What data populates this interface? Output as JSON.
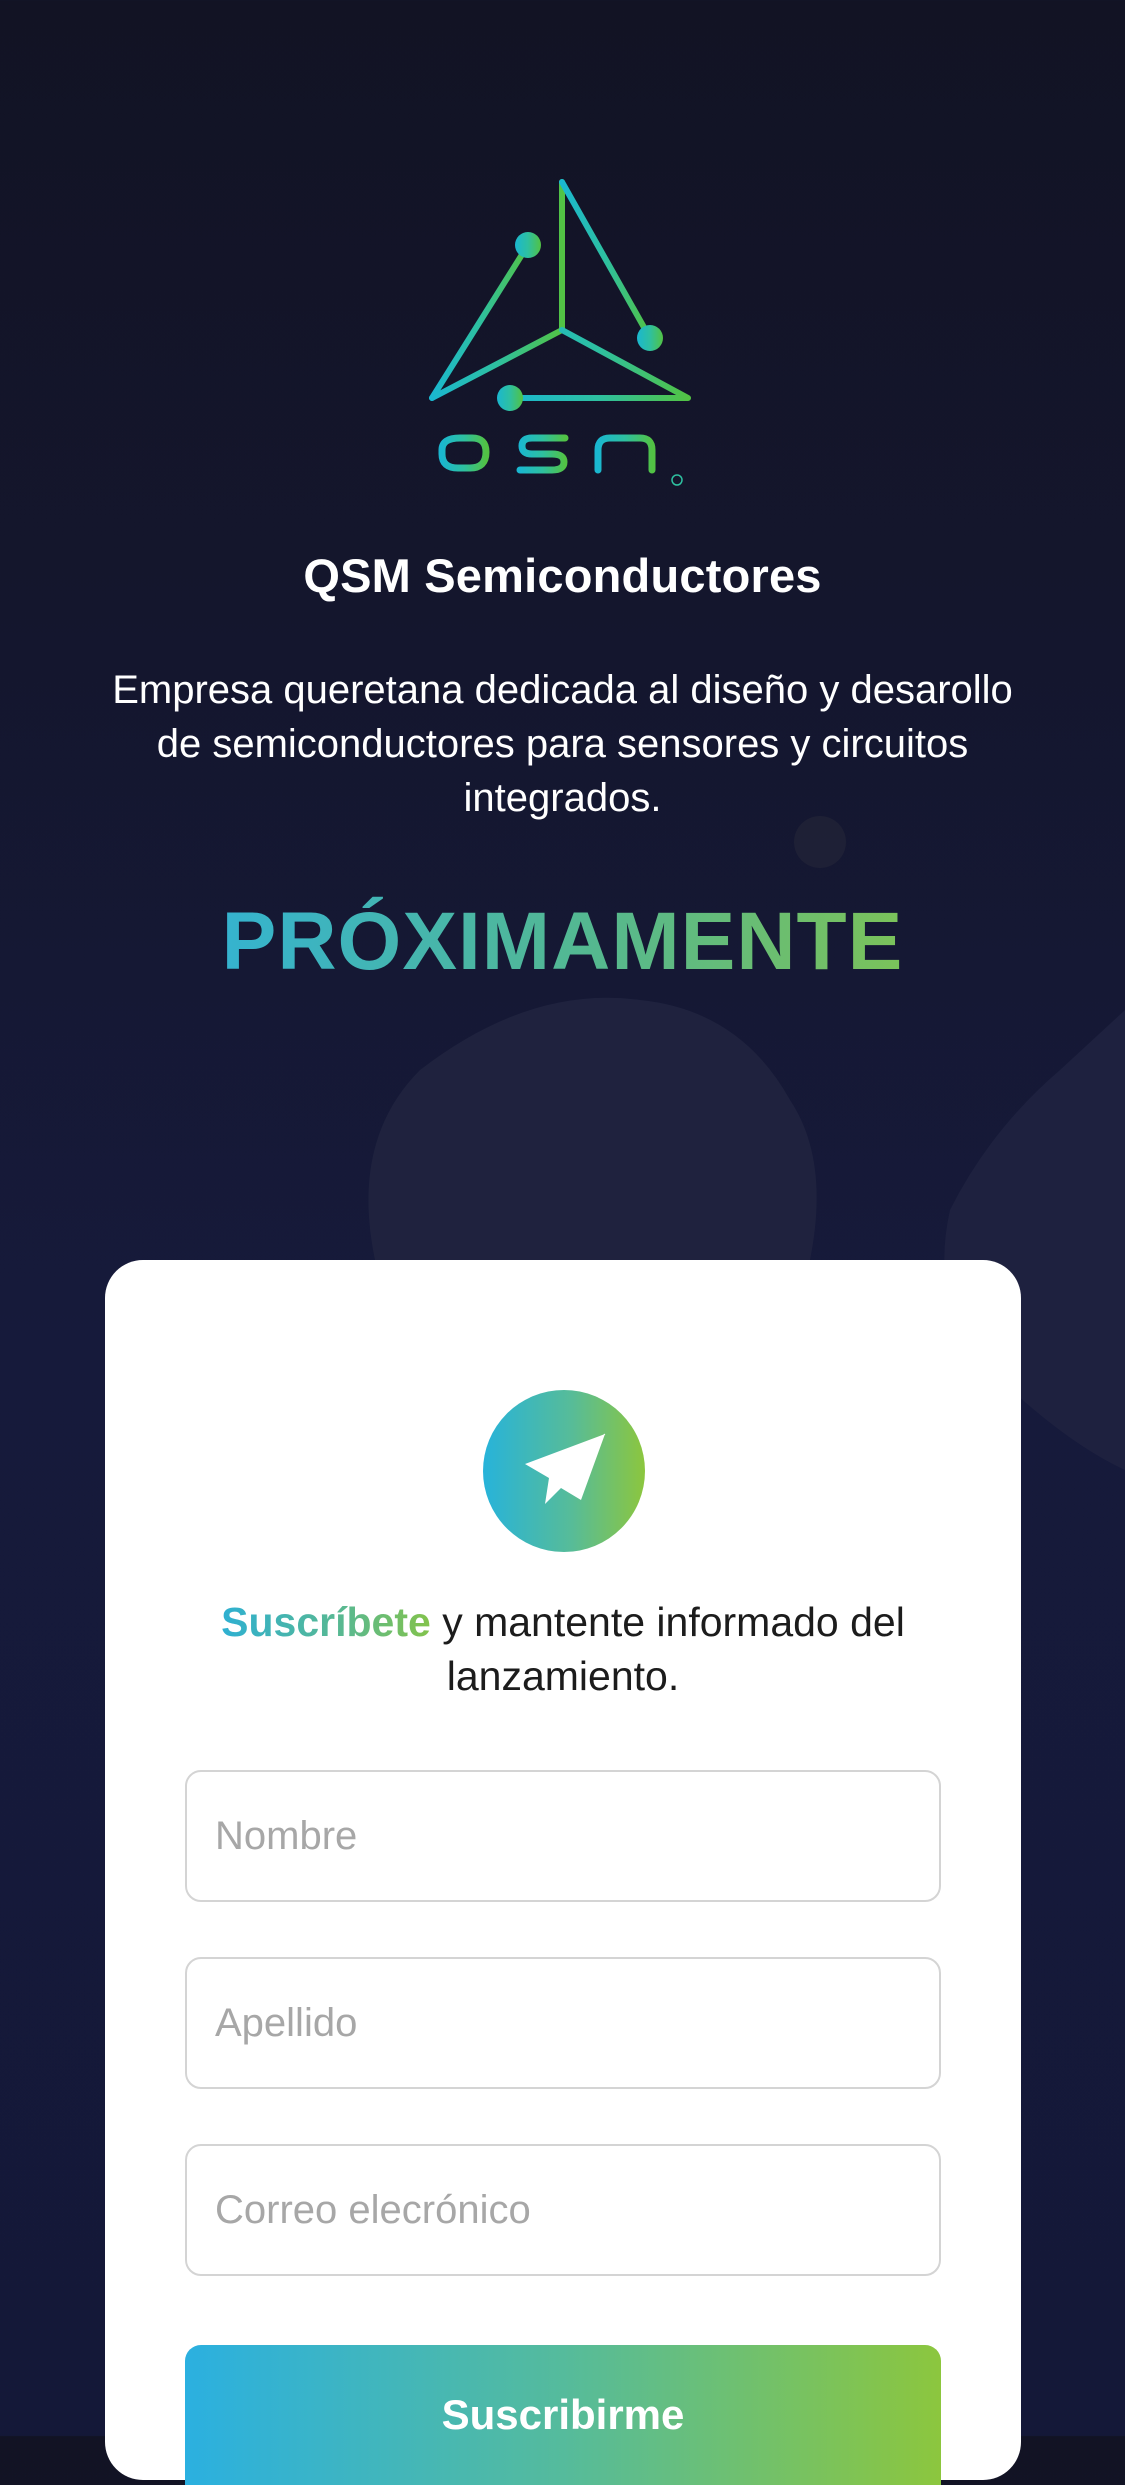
{
  "brand": {
    "logo_text": "QSM",
    "company_name": "QSM Semiconductores",
    "description": "Empresa queretana dedicada al diseño y desarollo de semiconductores para sensores y circuitos integrados.",
    "coming_soon": "PRÓXIMAMENTE",
    "colors": {
      "gradient_start": "#27b3da",
      "gradient_end": "#8cc63e",
      "background": "#14162d"
    }
  },
  "subscribe": {
    "icon": "paper-plane-icon",
    "highlight": "Suscríbete",
    "text": " y mantente informado del lanzamiento.",
    "fields": {
      "first_name_placeholder": "Nombre",
      "last_name_placeholder": "Apellido",
      "email_placeholder": "Correo elecrónico"
    },
    "button_label": "Suscribirme"
  }
}
